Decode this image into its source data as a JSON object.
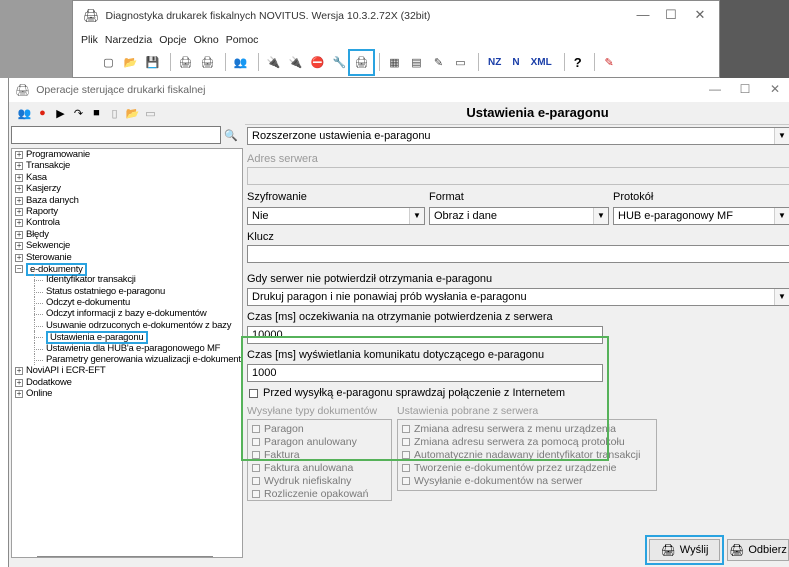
{
  "app": {
    "title": "Diagnostyka drukarek fiskalnych NOVITUS. Wersja 10.3.2.72X (32bit)",
    "menu": [
      "Plik",
      "Narzedzia",
      "Opcje",
      "Okno",
      "Pomoc"
    ],
    "window_controls": [
      "—",
      "☐",
      "✕"
    ],
    "toolbar_text_buttons": [
      "NZ",
      "N",
      "XML",
      "?"
    ]
  },
  "dialog": {
    "title": "Operacje sterujące drukarki fiskalnej",
    "window_controls": [
      "—",
      "☐",
      "✕"
    ]
  },
  "search": {
    "value": "",
    "placeholder": ""
  },
  "tree": {
    "top_items": [
      "Programowanie",
      "Transakcje",
      "Kasa",
      "Kasjerzy",
      "Baza danych",
      "Raporty",
      "Kontrola",
      "Błędy",
      "Sekwencje",
      "Sterowanie"
    ],
    "expanded_item": "e-dokumenty",
    "children": [
      "Identyfikator transakcji",
      "Status ostatniego e-paragonu",
      "Odczyt e-dokumentu",
      "Odczyt informacji z bazy e-dokumentów",
      "Usuwanie odrzuconych e-dokumentów z bazy",
      "Ustawienia e-paragonu",
      "Ustawienia dla HUB'a e-paragonowego MF",
      "Parametry generowania wizualizacji e-dokument"
    ],
    "selected_child": "Ustawienia e-paragonu",
    "bottom_items": [
      "NoviAPI i ECR-EFT",
      "Dodatkowe",
      "Online"
    ]
  },
  "settings": {
    "header": "Ustawienia e-paragonu",
    "mode_select": "Rozszerzone ustawienia e-paragonu",
    "server_label": "Adres serwera",
    "server_value": "",
    "encryption_label": "Szyfrowanie",
    "encryption_value": "Nie",
    "format_label": "Format",
    "format_value": "Obraz i dane",
    "protocol_label": "Protokół",
    "protocol_value": "HUB e-paragonowy MF",
    "key_label": "Klucz",
    "key_value": "",
    "no_confirm_label": "Gdy serwer nie potwierdził otrzymania e-paragonu",
    "no_confirm_value": "Drukuj paragon i nie ponawiaj prób wysłania e-paragonu",
    "wait_label": "Czas [ms] oczekiwania na otrzymanie potwierdzenia z serwera",
    "wait_value": "10000",
    "display_label": "Czas [ms] wyświetlania komunikatu dotyczącego e-paragonu",
    "display_value": "1000",
    "check_connection_label": "Przed wysyłką e-paragonu sprawdzaj połączenie z Internetem",
    "doc_types_label": "Wysyłane typy dokumentów",
    "doc_types": [
      "Paragon",
      "Paragon anulowany",
      "Faktura",
      "Faktura anulowana",
      "Wydruk niefiskalny",
      "Rozliczenie opakowań"
    ],
    "server_settings_label": "Ustawienia pobrane z serwera",
    "server_settings": [
      "Zmiana adresu serwera z menu urządzenia",
      "Zmiana adresu serwera za pomocą protokołu",
      "Automatycznie nadawany identyfikator transakcji",
      "Tworzenie e-dokumentów przez urządzenie",
      "Wysyłanie e-dokumentów na serwer"
    ]
  },
  "buttons": {
    "send": "Wyślij",
    "receive": "Odbierz"
  },
  "colors": {
    "highlight_blue": "#2aa3e0",
    "highlight_green": "#56b25a"
  }
}
